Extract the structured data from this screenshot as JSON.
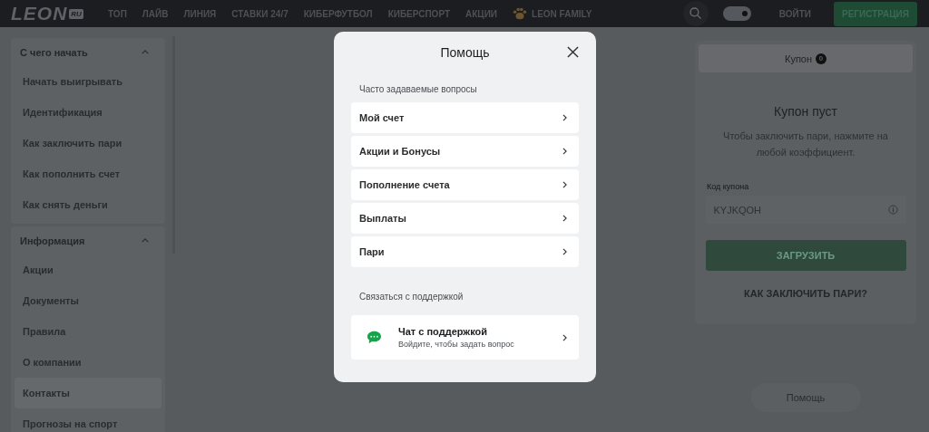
{
  "header": {
    "logo": "LEON",
    "logo_badge": "RU",
    "nav": [
      "ТОП",
      "ЛАЙВ",
      "ЛИНИЯ",
      "СТАВКИ 24/7",
      "КИБЕРФУТБОЛ",
      "КИБЕРСПОРТ",
      "АКЦИИ",
      "LEON FAMILY"
    ],
    "dark_theme_on": true,
    "login": "ВОЙТИ",
    "register": "РЕГИСТРАЦИЯ"
  },
  "sidebar": {
    "sections": [
      {
        "title": "С чего начать",
        "expanded": true,
        "items": [
          {
            "label": "Начать выигрывать",
            "selected": false
          },
          {
            "label": "Идентификация",
            "selected": false
          },
          {
            "label": "Как заключить пари",
            "selected": false
          },
          {
            "label": "Как пополнить счет",
            "selected": false
          },
          {
            "label": "Как снять деньги",
            "selected": false
          }
        ]
      },
      {
        "title": "Информация",
        "expanded": true,
        "items": [
          {
            "label": "Акции",
            "selected": false
          },
          {
            "label": "Документы",
            "selected": false
          },
          {
            "label": "Правила",
            "selected": false
          },
          {
            "label": "О компании",
            "selected": false
          },
          {
            "label": "Контакты",
            "selected": true
          },
          {
            "label": "Прогнозы на спорт",
            "selected": false
          }
        ]
      }
    ]
  },
  "coupon": {
    "tab": "Купон",
    "count": "0",
    "title": "Купон пуст",
    "hint": "Чтобы заключить пари, нажмите на любой коэффициент.",
    "code_label": "Код купона",
    "code_placeholder": "KYJKQOH",
    "load": "ЗАГРУЗИТЬ",
    "how": "КАК ЗАКЛЮЧИТЬ ПАРИ?"
  },
  "help_button": "Помощь",
  "modal": {
    "title": "Помощь",
    "faq_title": "Часто задаваемые вопросы",
    "faq": [
      "Мой счет",
      "Акции и Бонусы",
      "Пополнение счета",
      "Выплаты",
      "Пари"
    ],
    "contact_title": "Связаться с поддержкой",
    "chat_title": "Чат с поддержкой",
    "chat_subtitle": "Войдите, чтобы задать вопрос"
  }
}
